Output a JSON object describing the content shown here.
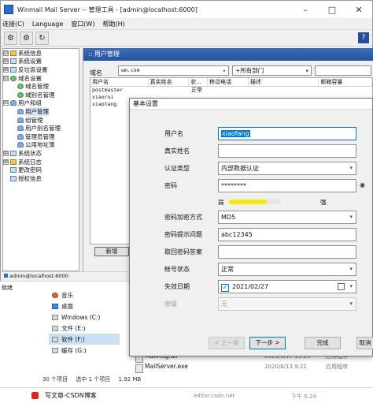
{
  "window": {
    "title": "Winmail Mail Server -- 管理工具 - [admin@localhost:6000]",
    "min_icon": "minimize-icon",
    "max_icon": "maximize-icon",
    "close_icon": "close-icon"
  },
  "menu": [
    "连接(C)",
    "Language",
    "窗口(W)",
    "帮助(H)"
  ],
  "tree": [
    {
      "label": "系统信息",
      "toggle": "⊟",
      "indent": 0,
      "icon": "folder"
    },
    {
      "label": "系统设置",
      "toggle": "⊞",
      "indent": 0,
      "icon": "gear"
    },
    {
      "label": "反垃圾设置",
      "toggle": "⊞",
      "indent": 0,
      "icon": "gear"
    },
    {
      "label": "域名设置",
      "toggle": "⊟",
      "indent": 0,
      "icon": "globe"
    },
    {
      "label": "域名管理",
      "toggle": "",
      "indent": 1,
      "icon": "globe"
    },
    {
      "label": "域别名管理",
      "toggle": "",
      "indent": 1,
      "icon": "globe"
    },
    {
      "label": "用户和组",
      "toggle": "⊟",
      "indent": 0,
      "icon": "person"
    },
    {
      "label": "用户管理",
      "toggle": "",
      "indent": 1,
      "icon": "person"
    },
    {
      "label": "组管理",
      "toggle": "",
      "indent": 1,
      "icon": "person"
    },
    {
      "label": "用户别名管理",
      "toggle": "",
      "indent": 1,
      "icon": "person"
    },
    {
      "label": "管理员管理",
      "toggle": "",
      "indent": 1,
      "icon": "person"
    },
    {
      "label": "公用地址簿",
      "toggle": "",
      "indent": 1,
      "icon": "person"
    },
    {
      "label": "系统状态",
      "toggle": "⊞",
      "indent": 0,
      "icon": "gear"
    },
    {
      "label": "系统日志",
      "toggle": "⊞",
      "indent": 0,
      "icon": "folder"
    },
    {
      "label": "更改密码",
      "toggle": "",
      "indent": 0,
      "icon": "gear"
    },
    {
      "label": "授权信息",
      "toggle": "",
      "indent": 0,
      "icon": "gear"
    }
  ],
  "panel": {
    "header": ":: 用户管理",
    "domain_label": "域名",
    "domain_value": "wm.com",
    "dept_value": "+所有部门",
    "columns": [
      "用户名",
      "真实姓名",
      "状...",
      "移动电话",
      "描述",
      "邮箱容量"
    ],
    "rows": [
      {
        "user": "postmaster",
        "realname": "",
        "status": "正常"
      },
      {
        "user": "xiaorui",
        "realname": "",
        "status": ""
      },
      {
        "user": "xiaotang",
        "realname": "",
        "status": ""
      }
    ],
    "new_button": "新增"
  },
  "status_bar": {
    "text": "admin@localhost:6000"
  },
  "explorer": {
    "title": "就绪",
    "nav": [
      {
        "label": "音乐",
        "icon": "music"
      },
      {
        "label": "桌面",
        "icon": "desk"
      },
      {
        "label": "Windows (C:)",
        "icon": "drive"
      },
      {
        "label": "文件 (E:)",
        "icon": "drive"
      },
      {
        "label": "软件 (F:)",
        "icon": "drive",
        "selected": true
      },
      {
        "label": "缓存 (G:)",
        "icon": "drive"
      }
    ],
    "files": [
      {
        "name": "MailMsg.dll",
        "date": "2020/6/17 15:29",
        "type": "应用程序"
      },
      {
        "name": "MailServer.exe",
        "date": "2020/8/13 9:22",
        "type": "应用程序"
      }
    ],
    "status": [
      "30 个项目",
      "选中 1 个项目",
      "1.92 MB"
    ]
  },
  "bottom": {
    "left": "写文章-CSDN博客",
    "mid": "editor.csdn.net",
    "right": "下午 5:24"
  },
  "dialog": {
    "title": "基本设置",
    "fields": {
      "username_label": "用户名",
      "username_value": "xiaofang",
      "realname_label": "真实姓名",
      "auth_label": "认证类型",
      "auth_value": "内部数据认证",
      "password_label": "密码",
      "password_value": "********",
      "weak_label": "弱",
      "strong_label": "强",
      "strength_fraction": 0.72,
      "encrypt_label": "密码加密方式",
      "encrypt_value": "MD5",
      "hint_q_label": "密码提示问题",
      "hint_q_value": "abc12345",
      "hint_a_label": "取回密码答案",
      "status_label": "帐号状态",
      "status_value": "正常",
      "effective_label": "失效日期",
      "effective_value": "2021/02/27",
      "dim_label": "密级",
      "dim_value": "无"
    },
    "buttons": {
      "prev": "< 上一步",
      "next": "下一步 >",
      "finish": "完成",
      "cancel": "取消"
    }
  }
}
